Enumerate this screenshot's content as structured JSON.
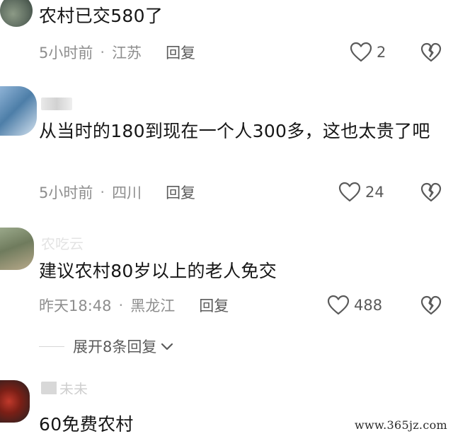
{
  "comments": [
    {
      "content": "农村已交580了",
      "time": "5小时前",
      "location": "江苏",
      "reply_label": "回复",
      "likes": "2",
      "like_icon": "heart-outline-icon",
      "dislike_icon": "broken-heart-icon"
    },
    {
      "content": "从当时的180到现在一个人300多，这也太贵了吧",
      "time": "5小时前",
      "location": "四川",
      "reply_label": "回复",
      "likes": "24",
      "like_icon": "heart-outline-icon",
      "dislike_icon": "broken-heart-icon"
    },
    {
      "nickname": "农吃云",
      "content": "建议农村80岁以上的老人免交",
      "time": "昨天18:48",
      "location": "黑龙江",
      "reply_label": "回复",
      "likes": "488",
      "like_icon": "heart-outline-icon",
      "dislike_icon": "broken-heart-icon",
      "expand_label": "展开8条回复"
    },
    {
      "nickname": "未未",
      "content": "60免费农村"
    }
  ],
  "separator": "·",
  "watermark": "www.365jz.com",
  "colors": {
    "text_primary": "#161616",
    "text_meta": "#8e8e8e",
    "reply": "#5b5b5b",
    "icon": "#5a5a5a"
  }
}
